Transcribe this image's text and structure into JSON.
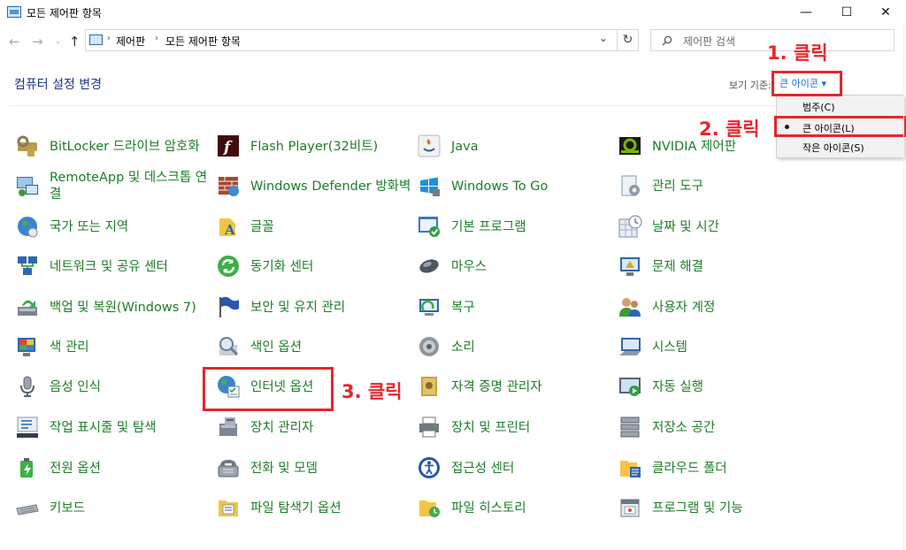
{
  "window": {
    "title": "모든 제어판 항목",
    "minimize": "—",
    "maximize": "☐",
    "close": "✕"
  },
  "address": {
    "crumbs": [
      "제어판",
      "모든 제어판 항목"
    ],
    "search_placeholder": "제어판 검색"
  },
  "header": {
    "title": "컴퓨터 설정 변경",
    "view_by_label": "보기 기준:",
    "view_value": "큰 아이콘 ▾"
  },
  "view_menu": {
    "items": [
      {
        "label": "범주(C)",
        "selected": false
      },
      {
        "label": "큰 아이콘(L)",
        "selected": true
      },
      {
        "label": "작은 아이콘(S)",
        "selected": false
      }
    ]
  },
  "annotations": {
    "step1": "1. 클릭",
    "step2": "2. 클릭",
    "step3": "3. 클릭",
    "color": "#e6262b"
  },
  "items": [
    {
      "label": "BitLocker 드라이브 암호화",
      "icon": "bitlocker-icon"
    },
    {
      "label": "Flash Player(32비트)",
      "icon": "flash-player-icon"
    },
    {
      "label": "Java",
      "icon": "java-icon"
    },
    {
      "label": "NVIDIA 제어판",
      "icon": "nvidia-icon"
    },
    {
      "label": "RemoteApp 및 데스크톱 연결",
      "icon": "remoteapp-icon"
    },
    {
      "label": "Windows Defender 방화벽",
      "icon": "firewall-icon"
    },
    {
      "label": "Windows To Go",
      "icon": "windows-to-go-icon"
    },
    {
      "label": "관리 도구",
      "icon": "admin-tools-icon"
    },
    {
      "label": "국가 또는 지역",
      "icon": "region-icon"
    },
    {
      "label": "글꼴",
      "icon": "fonts-icon"
    },
    {
      "label": "기본 프로그램",
      "icon": "default-programs-icon"
    },
    {
      "label": "날짜 및 시간",
      "icon": "date-time-icon"
    },
    {
      "label": "네트워크 및 공유 센터",
      "icon": "network-icon"
    },
    {
      "label": "동기화 센터",
      "icon": "sync-center-icon"
    },
    {
      "label": "마우스",
      "icon": "mouse-icon"
    },
    {
      "label": "문제 해결",
      "icon": "troubleshoot-icon"
    },
    {
      "label": "백업 및 복원(Windows 7)",
      "icon": "backup-icon"
    },
    {
      "label": "보안 및 유지 관리",
      "icon": "security-flag-icon"
    },
    {
      "label": "복구",
      "icon": "recovery-icon"
    },
    {
      "label": "사용자 계정",
      "icon": "user-accounts-icon"
    },
    {
      "label": "색 관리",
      "icon": "color-management-icon"
    },
    {
      "label": "색인 옵션",
      "icon": "indexing-icon"
    },
    {
      "label": "소리",
      "icon": "sound-icon"
    },
    {
      "label": "시스템",
      "icon": "system-icon"
    },
    {
      "label": "음성 인식",
      "icon": "microphone-icon"
    },
    {
      "label": "인터넷 옵션",
      "icon": "internet-options-icon"
    },
    {
      "label": "자격 증명 관리자",
      "icon": "credential-manager-icon"
    },
    {
      "label": "자동 실행",
      "icon": "autoplay-icon"
    },
    {
      "label": "작업 표시줄 및 탐색",
      "icon": "taskbar-icon"
    },
    {
      "label": "장치 관리자",
      "icon": "device-manager-icon"
    },
    {
      "label": "장치 및 프린터",
      "icon": "devices-printers-icon"
    },
    {
      "label": "저장소 공간",
      "icon": "storage-spaces-icon"
    },
    {
      "label": "전원 옵션",
      "icon": "power-options-icon"
    },
    {
      "label": "전화 및 모뎀",
      "icon": "phone-modem-icon"
    },
    {
      "label": "접근성 센터",
      "icon": "ease-of-access-icon"
    },
    {
      "label": "클라우드 폴더",
      "icon": "work-folders-icon"
    },
    {
      "label": "키보드",
      "icon": "keyboard-icon"
    },
    {
      "label": "파일 탐색기 옵션",
      "icon": "folder-options-icon"
    },
    {
      "label": "파일 히스토리",
      "icon": "file-history-icon"
    },
    {
      "label": "프로그램 및 기능",
      "icon": "programs-features-icon"
    }
  ]
}
